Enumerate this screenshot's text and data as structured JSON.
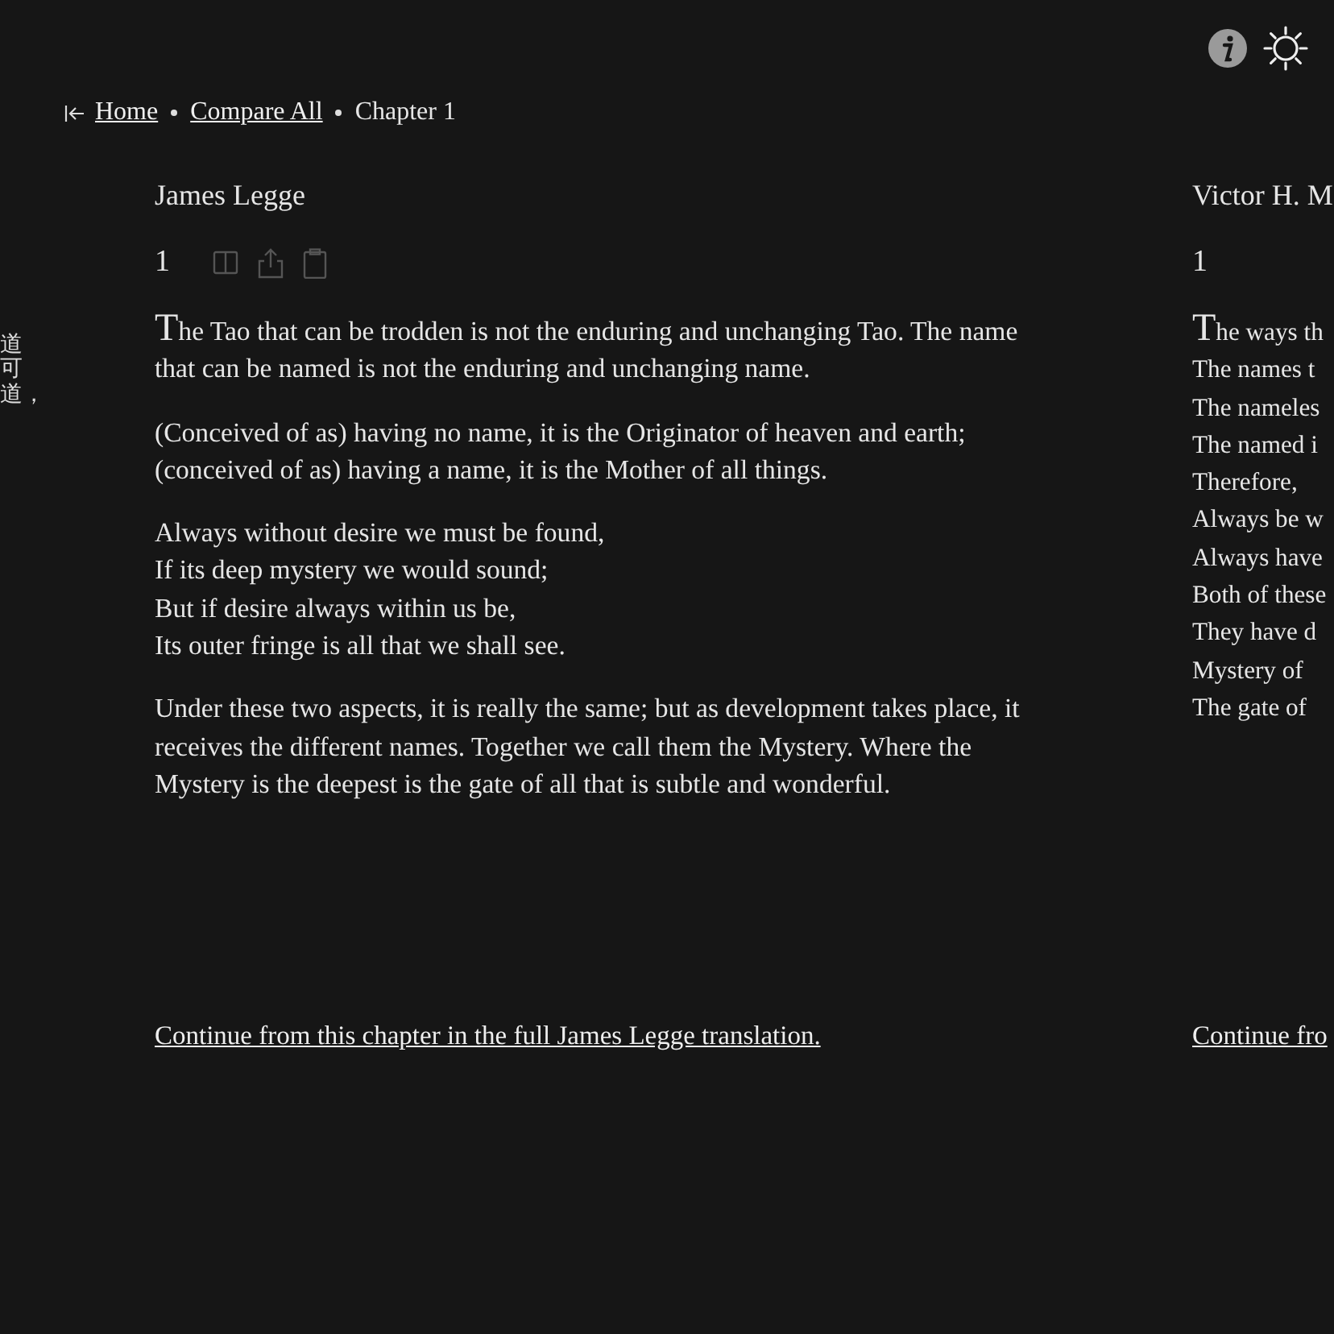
{
  "vertical_text": "道可道，",
  "breadcrumb": {
    "items": [
      {
        "label": "Home",
        "kind": "link"
      },
      {
        "label": "Compare All",
        "kind": "link"
      },
      {
        "label": "Chapter 1",
        "kind": "current"
      }
    ]
  },
  "translations": [
    {
      "translator": "James Legge",
      "chapter": "1",
      "tools": true,
      "paragraphs": [
        {
          "lines": [
            "The Tao that can be trodden is not the enduring and unchanging Tao. The name that can be named is not the enduring and unchanging name."
          ]
        },
        {
          "lines": [
            "(Conceived of as) having no name, it is the Originator of heaven and earth; (conceived of as) having a name, it is the Mother of all things."
          ]
        },
        {
          "lines": [
            "Always without desire we must be found,",
            "If its deep mystery we would sound;",
            "But if desire always within us be,",
            "Its outer fringe is all that we shall see."
          ]
        },
        {
          "lines": [
            "Under these two aspects, it is really the same; but as development takes place, it receives the different names. Together we call them the Mystery. Where the Mystery is the deepest is the gate of all that is subtle and wonderful."
          ]
        }
      ],
      "continue_link": "Continue from this chapter in the full James Legge translation."
    },
    {
      "translator": "Victor H. M",
      "chapter": "1",
      "tools": false,
      "paragraphs": [
        {
          "lines": [
            "The ways th",
            "The names t",
            "The nameles",
            "The named i",
            "Therefore,",
            "Always be w",
            "Always have",
            "Both of these",
            "They have d",
            "Mystery of",
            "The gate of"
          ]
        }
      ],
      "continue_link": "Continue fro"
    }
  ]
}
